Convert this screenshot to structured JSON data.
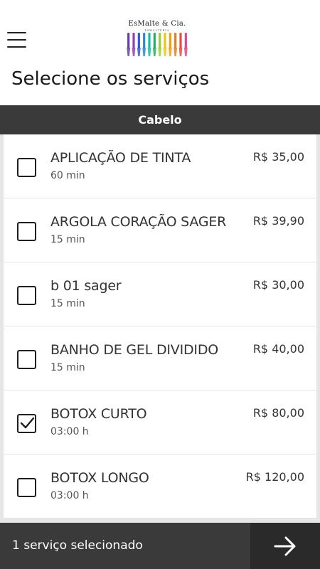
{
  "header": {
    "logo_text": "EsMalte & Cia.",
    "logo_sub": "ESMALTERIA",
    "page_title": "Selecione os serviços"
  },
  "category": {
    "name": "Cabelo"
  },
  "services": [
    {
      "name": "APLICAÇÃO DE TINTA",
      "duration": "60 min",
      "price": "R$ 35,00",
      "selected": false
    },
    {
      "name": "ARGOLA CORAÇÃO SAGER",
      "duration": "15 min",
      "price": "R$ 39,90",
      "selected": false
    },
    {
      "name": "b 01 sager",
      "duration": "15 min",
      "price": "R$ 30,00",
      "selected": false
    },
    {
      "name": "BANHO DE GEL DIVIDIDO",
      "duration": "15 min",
      "price": "R$ 40,00",
      "selected": false
    },
    {
      "name": "BOTOX CURTO",
      "duration": "03:00 h",
      "price": "R$ 80,00",
      "selected": true
    },
    {
      "name": "BOTOX LONGO",
      "duration": "03:00 h",
      "price": "R$ 120,00",
      "selected": false
    }
  ],
  "footer": {
    "selection_text": "1 serviço selecionado",
    "next_icon": "arrow-right-icon"
  },
  "colors": {
    "bar": "#3a3a3a",
    "next_button": "#2a2a2a",
    "logo_brushes": [
      "#6b3fa0",
      "#8e44ad",
      "#3455db",
      "#2e86de",
      "#1abc9c",
      "#27ae60",
      "#9acd32",
      "#f1c40f",
      "#f39c12",
      "#e67e22",
      "#e74c3c",
      "#e84393"
    ]
  }
}
